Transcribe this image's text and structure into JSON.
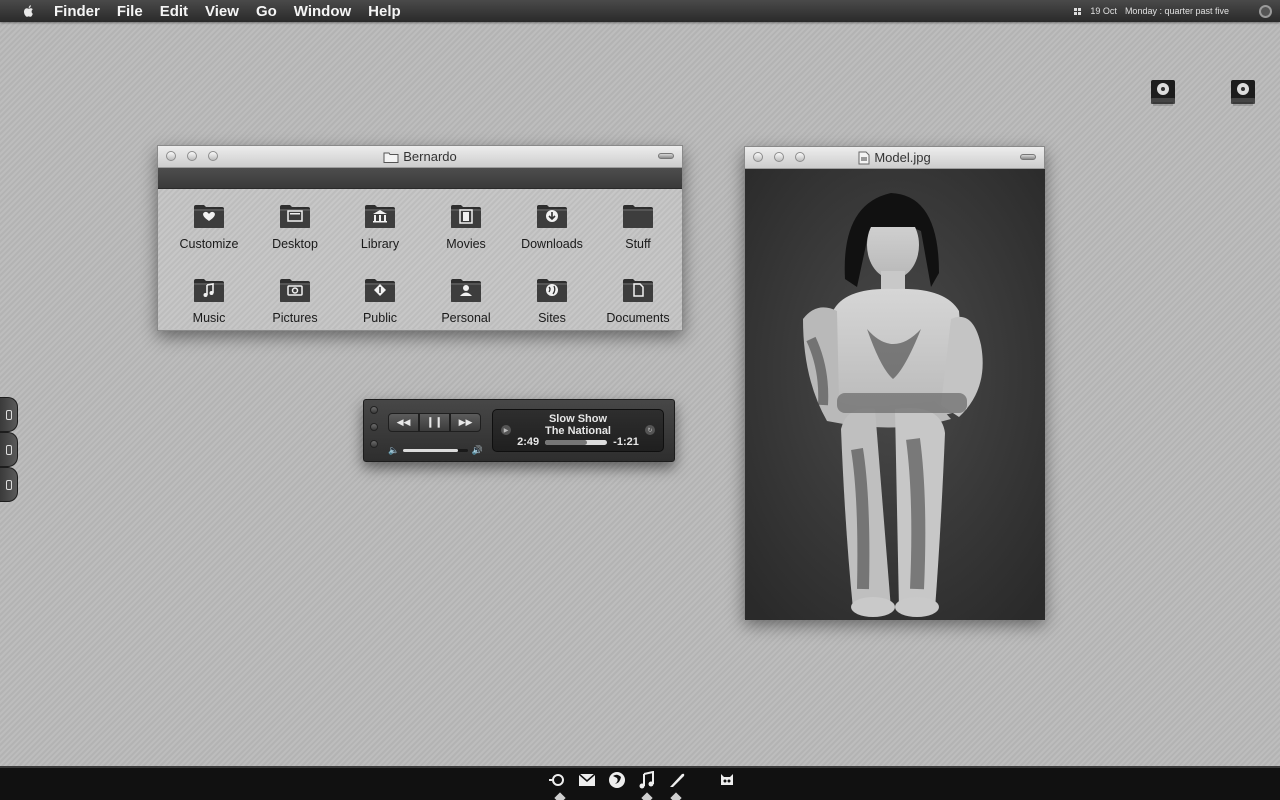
{
  "menubar": {
    "apple_icon": "apple-icon",
    "app_name": "Finder",
    "items": [
      "File",
      "Edit",
      "View",
      "Go",
      "Window",
      "Help"
    ],
    "date": "19 Oct",
    "time_text": "Monday : quarter past five"
  },
  "finder_window": {
    "title": "Bernardo",
    "folders": [
      {
        "label": "Customize",
        "icon": "heart-icon"
      },
      {
        "label": "Desktop",
        "icon": "desktop-icon"
      },
      {
        "label": "Library",
        "icon": "library-icon"
      },
      {
        "label": "Movies",
        "icon": "film-icon"
      },
      {
        "label": "Downloads",
        "icon": "download-icon"
      },
      {
        "label": "Stuff",
        "icon": "folder-icon"
      },
      {
        "label": "Music",
        "icon": "music-note-icon"
      },
      {
        "label": "Pictures",
        "icon": "camera-icon"
      },
      {
        "label": "Public",
        "icon": "public-icon"
      },
      {
        "label": "Personal",
        "icon": "person-icon"
      },
      {
        "label": "Sites",
        "icon": "globe-icon"
      },
      {
        "label": "Documents",
        "icon": "document-icon"
      }
    ]
  },
  "photo_window": {
    "title": "Model.jpg"
  },
  "player": {
    "song": "Slow Show",
    "artist": "The National",
    "elapsed": "2:49",
    "remaining": "-1:21",
    "progress": 0.68,
    "volume": 0.85
  },
  "dock": {
    "items": [
      "spotlight-icon",
      "mail-icon",
      "firefox-icon",
      "itunes-icon",
      "quill-icon",
      "raccoon-icon"
    ]
  }
}
